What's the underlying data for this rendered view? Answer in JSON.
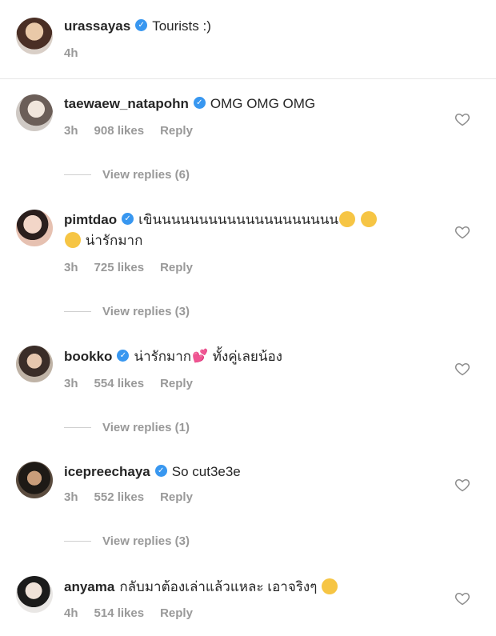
{
  "post": {
    "username": "urassayas",
    "caption": "Tourists :)",
    "time": "4h"
  },
  "comments": [
    {
      "username": "taewaew_natapohn",
      "text": "OMG OMG OMG",
      "time": "3h",
      "likes": "908 likes",
      "reply": "Reply",
      "view_replies": "View replies (6)"
    },
    {
      "username": "pimtdao",
      "text": "เขินนนนนนนนนนนนนนนนนนนน",
      "text2": "น่ารักมาก",
      "time": "3h",
      "likes": "725 likes",
      "reply": "Reply",
      "view_replies": "View replies (3)"
    },
    {
      "username": "bookko",
      "text": "น่ารักมาก",
      "text_after": "ทั้งคู่เลยน้อง",
      "time": "3h",
      "likes": "554 likes",
      "reply": "Reply",
      "view_replies": "View replies (1)"
    },
    {
      "username": "icepreechaya",
      "text": "So cut3e3e",
      "time": "3h",
      "likes": "552 likes",
      "reply": "Reply",
      "view_replies": "View replies (3)"
    },
    {
      "username": "anyama",
      "text": "กลับมาต้องเล่าแล้วแหละ เอาจริงๆ",
      "time": "4h",
      "likes": "514 likes",
      "reply": "Reply"
    }
  ],
  "icons": {
    "verified": "verified-badge-icon",
    "like": "heart-outline-icon",
    "emoji_blush": "smiling-face-emoji",
    "emoji_hearts": "two-hearts-emoji",
    "emoji_shush": "shushing-face-emoji"
  },
  "colors": {
    "verified": "#3897f0",
    "muted": "#999999",
    "text": "#262626"
  }
}
